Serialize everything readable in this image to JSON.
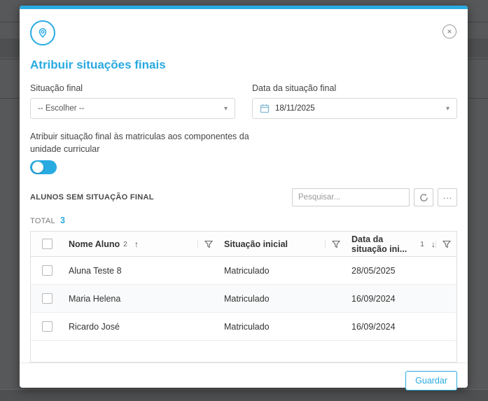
{
  "modal": {
    "close_glyph": "×",
    "title": "Atribuir situações finais",
    "form": {
      "situacao": {
        "label": "Situação final",
        "value": "-- Escolher --"
      },
      "data": {
        "label": "Data da situação final",
        "value": "18/11/2025"
      }
    },
    "toggle_text": "Atribuir situação final às matriculas aos componentes da unidade curricular",
    "toggle_state": "on",
    "list": {
      "heading": "ALUNOS SEM SITUAÇÃO FINAL",
      "search_placeholder": "Pesquisar...",
      "more_glyph": "···",
      "total_label": "TOTAL",
      "total_value": "3"
    },
    "table": {
      "columns": [
        {
          "label": "Nome Aluno",
          "order": "2",
          "sort": "↑"
        },
        {
          "label": "Situação inicial",
          "order": "",
          "sort": ""
        },
        {
          "label": "Data da situação ini...",
          "order": "1",
          "sort": "↓"
        }
      ],
      "rows": [
        {
          "name": "Aluna Teste 8",
          "status": "Matriculado",
          "date": "28/05/2025"
        },
        {
          "name": "Maria Helena",
          "status": "Matriculado",
          "date": "16/09/2024"
        },
        {
          "name": "Ricardo José",
          "status": "Matriculado",
          "date": "16/09/2024"
        }
      ]
    },
    "footer": {
      "save": "Guardar"
    },
    "colors": {
      "accent": "#29abe2"
    }
  }
}
